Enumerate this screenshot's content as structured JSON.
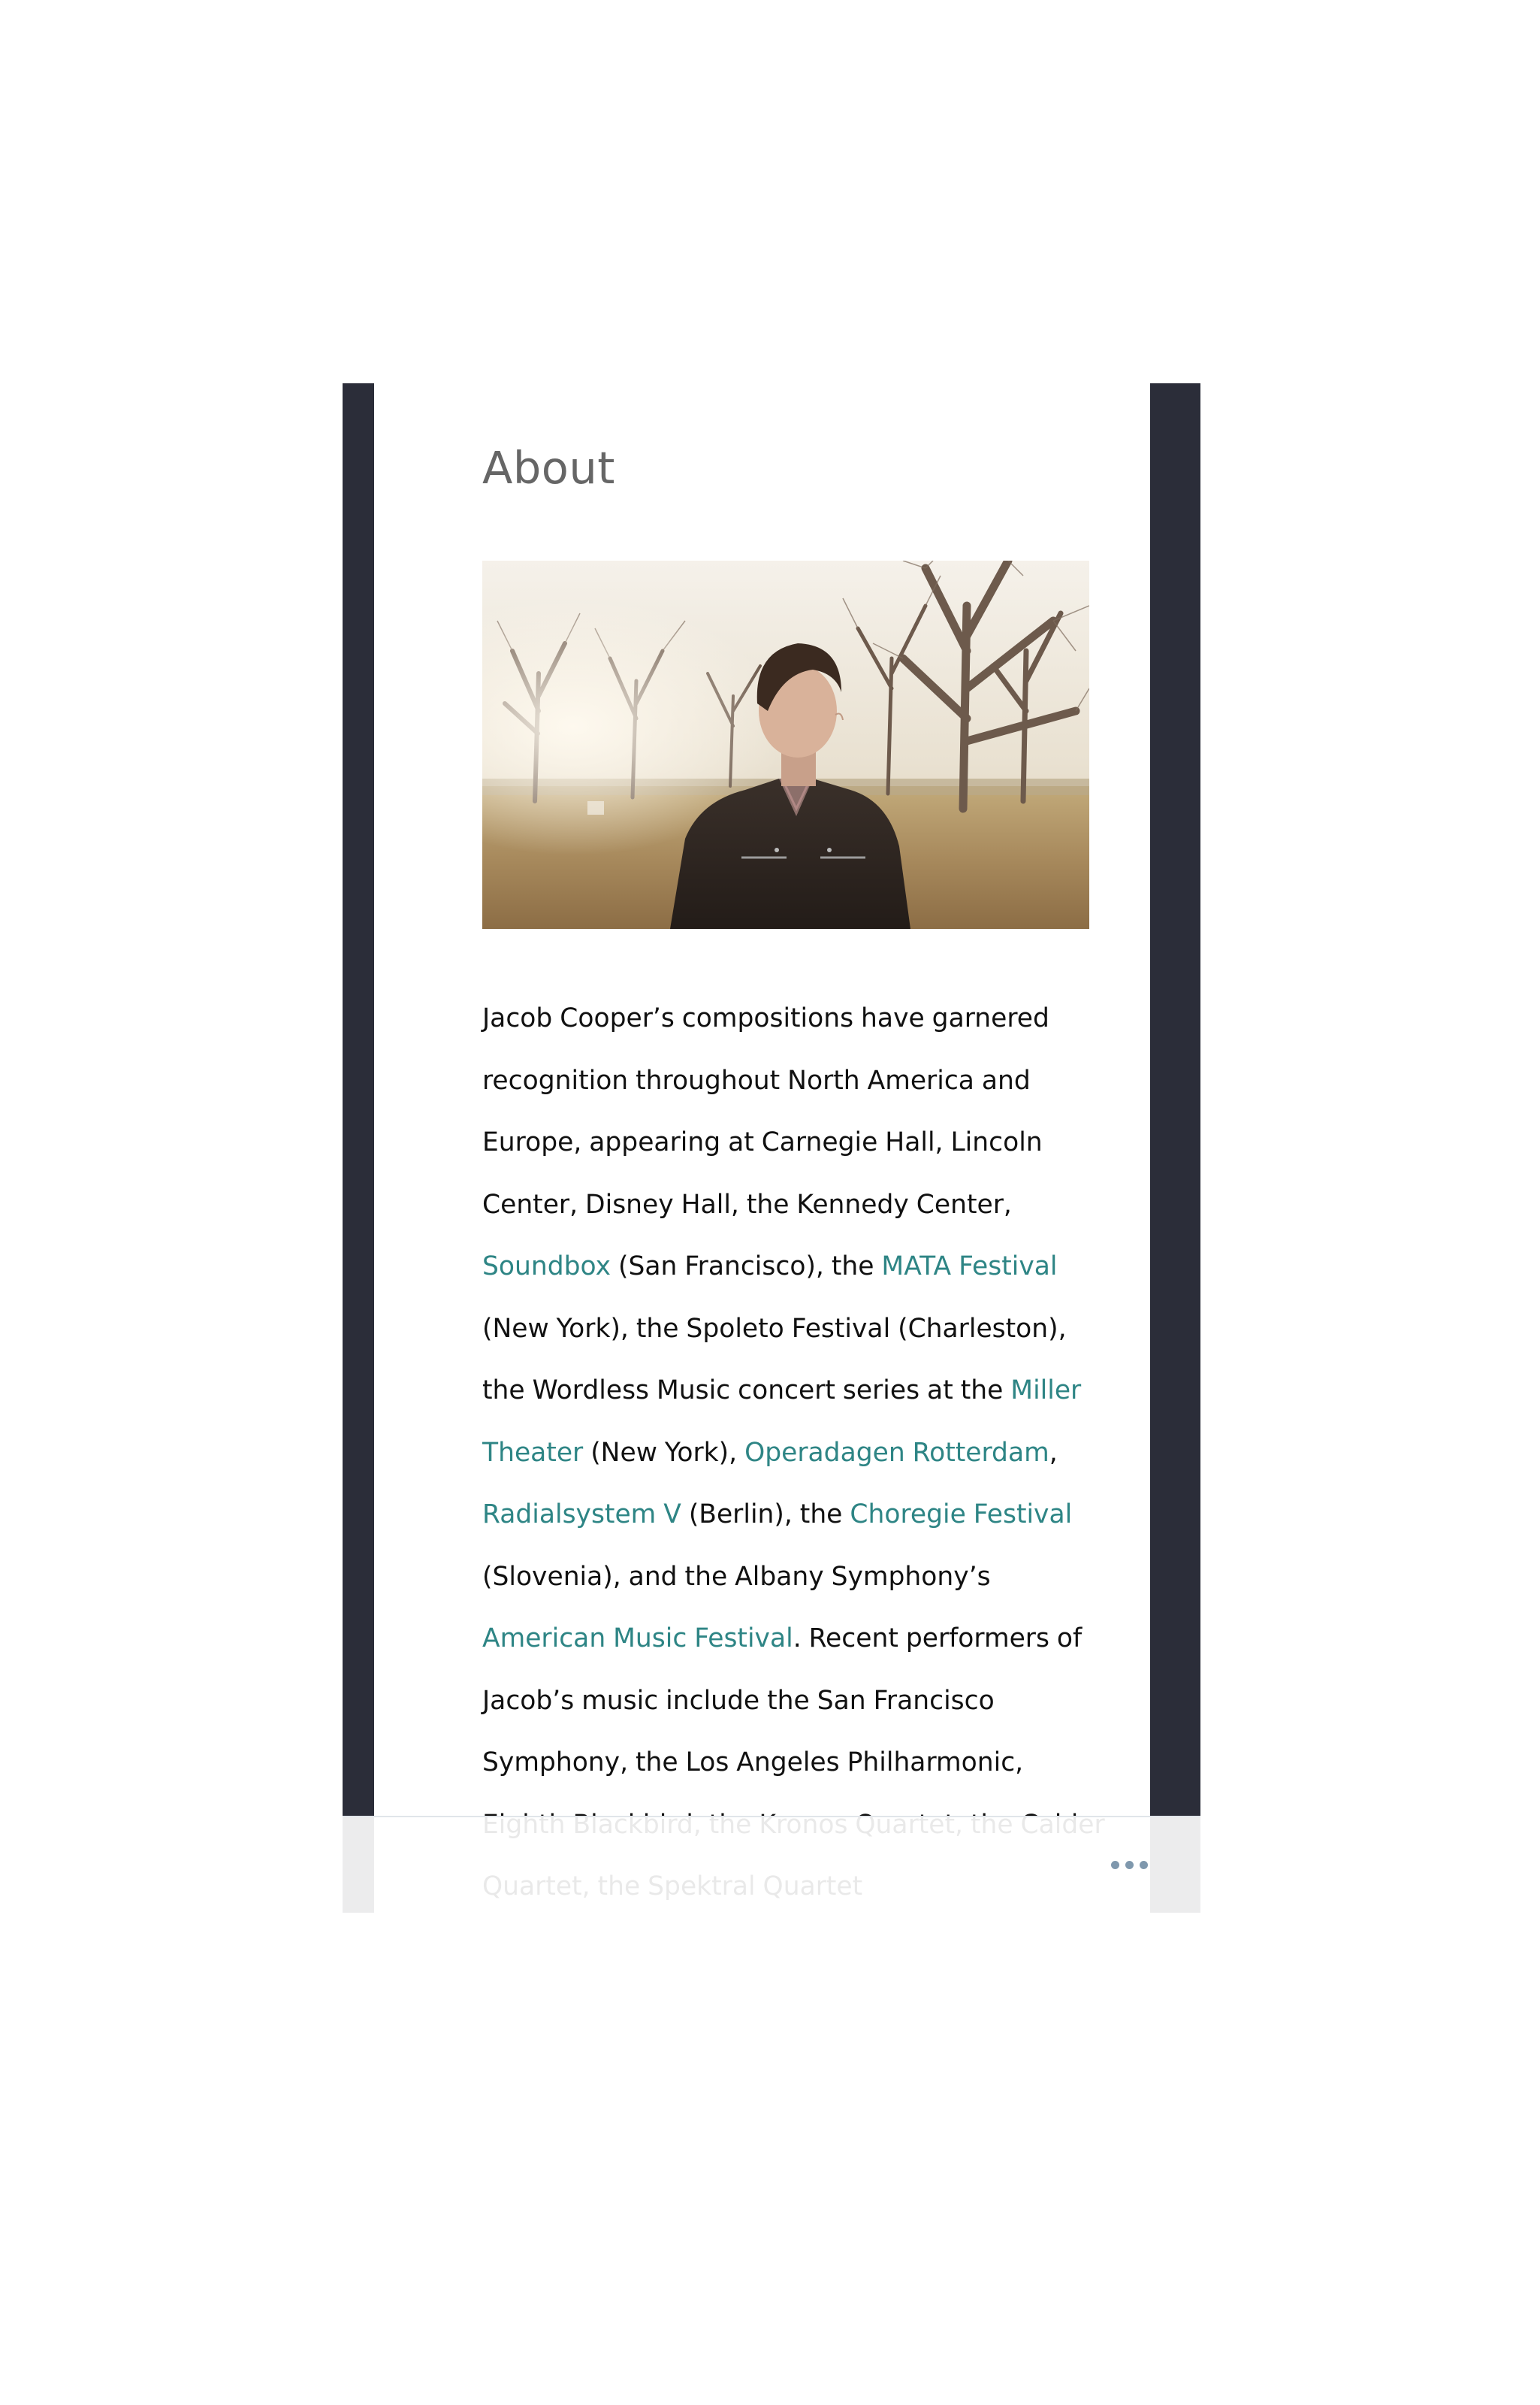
{
  "about": {
    "title": "About"
  },
  "hero": {
    "alt": "Jacob Cooper standing outdoors among bare trees"
  },
  "bio": {
    "t1": "Jacob Cooper’s compositions have garnered recognition throughout North America and Europe, appearing at Carnegie Hall, Lincoln Center, Disney Hall, the Kennedy Center, ",
    "l1": "Soundbox",
    "t2": " (San Francisco), the ",
    "l2": "MATA Festival",
    "t3": " (New York), the Spoleto Festival (Charleston), the Wordless Music concert series at the ",
    "l3": "Miller Theater",
    "t4": " (New York), ",
    "l4": "Operadagen Rotterdam",
    "t5": ", ",
    "l5": "Radialsystem V",
    "t6": " (Berlin), the ",
    "l6": "Choregie Festival",
    "t7": " (Slovenia), and the Albany Symphony’s ",
    "l7": "American Music Festival",
    "t8": ". Recent performers of Jacob’s music include the San Francisco Symphony, the Los Angeles Philharmonic, Eighth Blackbird, the Kronos Quartet, the Calder Quartet, the Spektral Quartet"
  },
  "toolbar": {
    "more_label": "More options"
  },
  "colors": {
    "frame": "#2b2d39",
    "link": "#2e8585",
    "title": "#666666",
    "more_icon": "#7f98ad"
  }
}
